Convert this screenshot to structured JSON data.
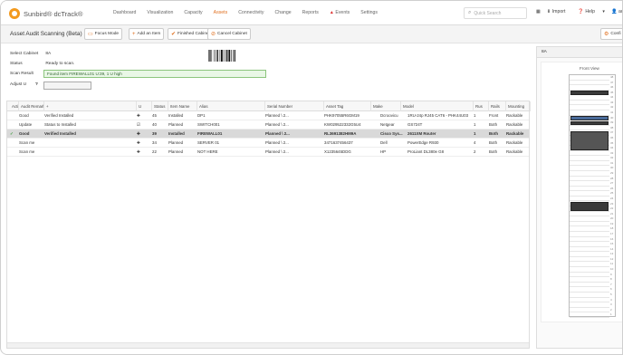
{
  "app": {
    "logo_text": "Sunbird® dcTrack®",
    "nav": [
      {
        "label": "Dashboard",
        "active": false
      },
      {
        "label": "Visualization",
        "active": false
      },
      {
        "label": "Capacity",
        "active": false
      },
      {
        "label": "Assets",
        "active": true
      },
      {
        "label": "Connectivity",
        "active": false
      },
      {
        "label": "Change",
        "active": false
      },
      {
        "label": "Reports",
        "active": false
      },
      {
        "label": "Events",
        "active": false,
        "alert": true
      },
      {
        "label": "Settings",
        "active": false
      }
    ],
    "search_placeholder": "Quick Search",
    "import_label": "Import",
    "help_label": "Help",
    "user_label": "admin",
    "accent_color": "#e07020"
  },
  "page": {
    "title": "Asset Audit Scanning (Beta)",
    "toolbar": {
      "focus_mode": "Focus Mode",
      "add_item": "Add an Item",
      "finished_cabinet": "Finished Cabinet",
      "cancel_cabinet": "Cancel Cabinet",
      "configure": "Confi"
    }
  },
  "form": {
    "select_cabinet_label": "Select Cabinet",
    "select_cabinet_value": "8A",
    "status_label": "Status",
    "status_value": "Ready to scan.",
    "scan_result_label": "Scan Result",
    "scan_result_value": "Found item FIREWALL01 U:39, 1 U high",
    "adjust_u_label": "Adjust U",
    "adjust_u_value": ""
  },
  "grid": {
    "columns": [
      "Action",
      "Audit Remarks",
      "+",
      "U",
      "Status",
      "Item Name",
      "Alias",
      "Serial Number",
      "Asset Tag",
      "Make",
      "Model",
      "Rus",
      "Rails",
      "Mounting"
    ],
    "rows": [
      {
        "check": "",
        "action": "Good",
        "remarks": "Verified Installed",
        "icon": "✚",
        "u": "45",
        "status": "Installed",
        "name": "DP1",
        "alias": "Planned \\ 2...",
        "serial": "PHK97055R6GM19",
        "tag": "",
        "make": "Dcroovicu",
        "model": "1RU-24p RJ45 CAT6 - PHK44U03",
        "rus": "1",
        "rails": "Front",
        "mounting": "Rackable",
        "selected": false
      },
      {
        "check": "",
        "action": "Update",
        "remarks": "Status to Installed",
        "icon": "☑",
        "u": "40",
        "status": "Planned",
        "name": "SWITCH001",
        "alias": "Planned \\ 2...",
        "serial": "KW029522332G5U4",
        "tag": "",
        "make": "Netgear",
        "model": "GS724T",
        "rus": "1",
        "rails": "Both",
        "mounting": "Rackable",
        "selected": false
      },
      {
        "check": "✓",
        "action": "Good",
        "remarks": "Verified Installed",
        "icon": "✚",
        "u": "39",
        "status": "Installed",
        "name": "FIREWALL01",
        "alias": "Planned \\ 2...",
        "serial": "RL3691382HM9A",
        "tag": "",
        "make": "Cisco Sys...",
        "model": "2611XM Router",
        "rus": "1",
        "rails": "Both",
        "mounting": "Rackable",
        "selected": true
      },
      {
        "check": "",
        "action": "Scan me",
        "remarks": "",
        "icon": "✚",
        "u": "34",
        "status": "Planned",
        "name": "SERVER 01",
        "alias": "Planned \\ 2...",
        "serial": "3471637456437",
        "tag": "",
        "make": "Dell",
        "model": "PowerEdge R930",
        "rus": "4",
        "rails": "Both",
        "mounting": "Rackable",
        "selected": false
      },
      {
        "check": "",
        "action": "Scan me",
        "remarks": "",
        "icon": "✚",
        "u": "22",
        "status": "Planned",
        "name": "NOT HERE",
        "alias": "Planned \\ 2...",
        "serial": "X1235645DDG",
        "tag": "",
        "make": "HP",
        "model": "ProLiant DL380e G8",
        "rus": "2",
        "rails": "Both",
        "mounting": "Rackable",
        "selected": false
      }
    ]
  },
  "rack_panel": {
    "title": "8A",
    "view_label": "Front View",
    "u_numbers": [
      "48",
      "47",
      "46",
      "45",
      "44",
      "43",
      "42",
      "41",
      "40",
      "39",
      "38",
      "37",
      "36",
      "35",
      "34",
      "33",
      "32",
      "31",
      "30",
      "29",
      "28",
      "27",
      "26",
      "25",
      "24",
      "23",
      "22",
      "21",
      "20",
      "19",
      "18",
      "17",
      "16",
      "15",
      "14",
      "13",
      "12",
      "11",
      "10",
      "9",
      "8",
      "7",
      "6",
      "5",
      "4",
      "3",
      "2",
      "1"
    ]
  }
}
